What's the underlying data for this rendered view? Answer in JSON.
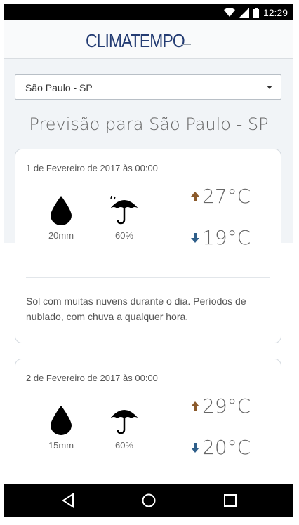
{
  "status_bar": {
    "time": "12:29"
  },
  "header": {
    "logo_text": "CLIMATEMPO"
  },
  "location_select": {
    "value": "São Paulo - SP"
  },
  "page_title": "Previsão para São Paulo - SP",
  "forecasts": [
    {
      "date": "1 de Fevereiro de 2017 às 00:00",
      "rain": "20mm",
      "rain_probability": "60%",
      "temp_max": "27°C",
      "temp_min": "19°C",
      "description": "Sol com muitas nuvens durante o dia. Períodos de nublado, com chuva a qualquer hora."
    },
    {
      "date": "2 de Fevereiro de 2017 às 00:00",
      "rain": "15mm",
      "rain_probability": "60%",
      "temp_max": "29°C",
      "temp_min": "20°C"
    }
  ],
  "colors": {
    "max_arrow": "#8b5a2b",
    "min_arrow": "#2f5f8a",
    "logo": "#243c73"
  }
}
